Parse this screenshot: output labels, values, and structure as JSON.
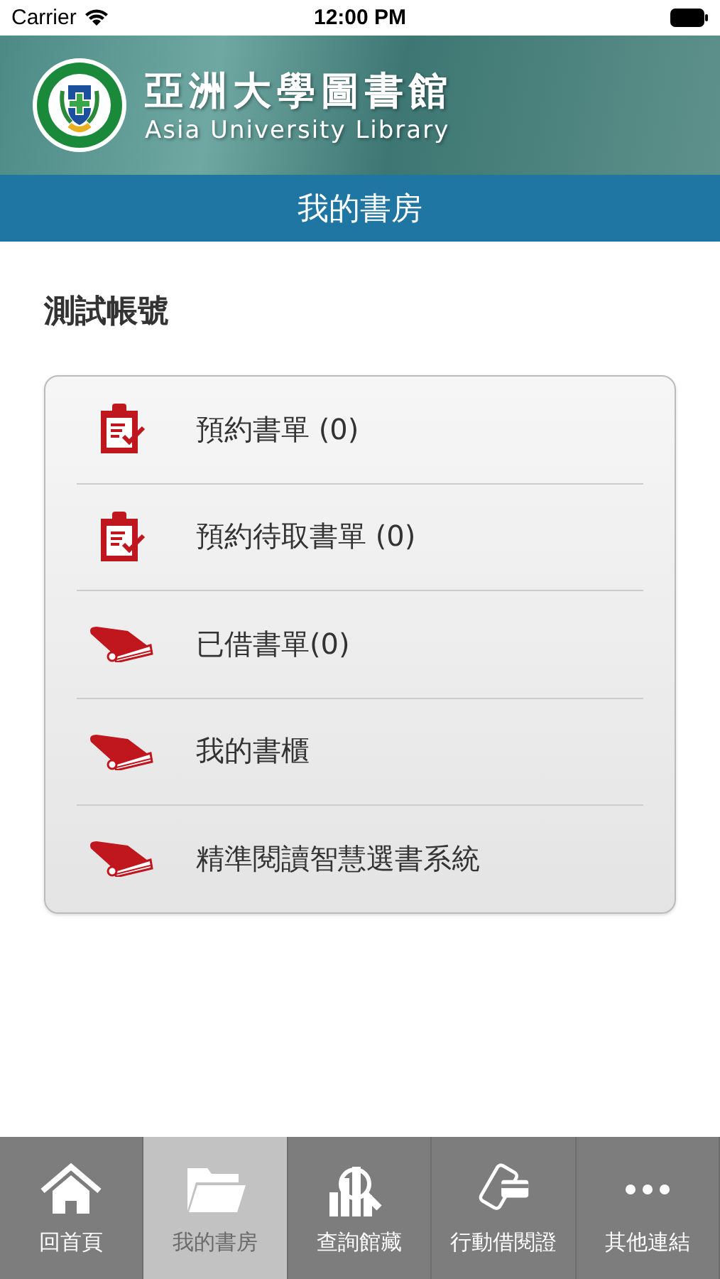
{
  "status_bar": {
    "carrier": "Carrier",
    "time": "12:00 PM"
  },
  "header": {
    "title": "亞洲大學圖書館",
    "subtitle": "Asia University Library"
  },
  "page_title": "我的書房",
  "account": "測試帳號",
  "menu": [
    {
      "kind": "clipboard",
      "label": "預約書單 (0)"
    },
    {
      "kind": "clipboard",
      "label": "預約待取書單 (0)"
    },
    {
      "kind": "book",
      "label": "已借書單(0)"
    },
    {
      "kind": "book",
      "label": "我的書櫃"
    },
    {
      "kind": "book",
      "label": "精準閱讀智慧選書系統"
    }
  ],
  "tabs": [
    {
      "kind": "home",
      "label": "回首頁",
      "selected": false
    },
    {
      "kind": "folder",
      "label": "我的書房",
      "selected": true
    },
    {
      "kind": "search",
      "label": "查詢館藏",
      "selected": false
    },
    {
      "kind": "phone",
      "label": "行動借閱證",
      "selected": false
    },
    {
      "kind": "more",
      "label": "其他連結",
      "selected": false
    }
  ]
}
